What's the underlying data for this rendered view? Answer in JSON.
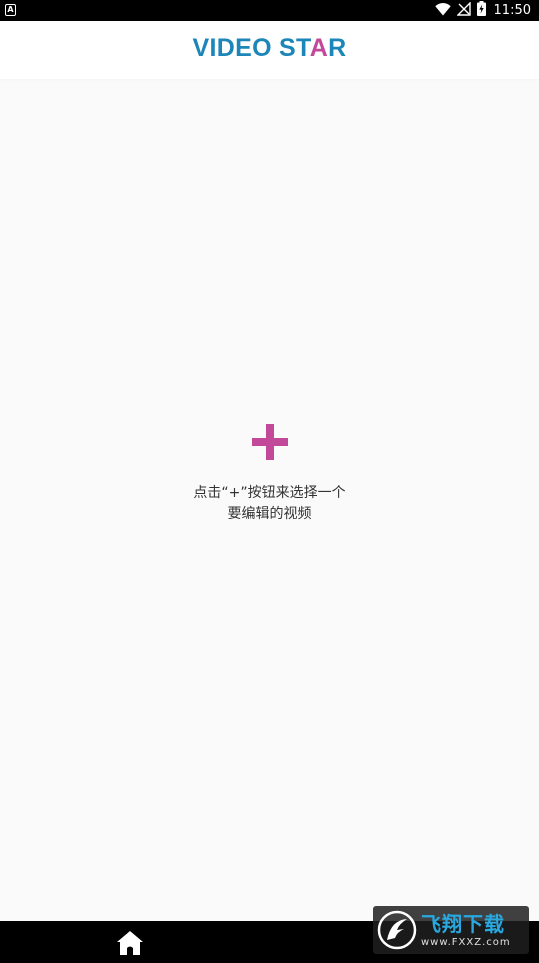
{
  "status_bar": {
    "app_indicator": "A",
    "time": "11:50",
    "icons": [
      "wifi-icon",
      "signal-off-icon",
      "battery-charging-icon"
    ]
  },
  "app_bar": {
    "title_part1": "VIDEO ST",
    "title_accent": "A",
    "title_part2": "R",
    "title_color": "#1d86b8",
    "accent_color": "#c2489a"
  },
  "empty_state": {
    "add_icon": "plus-icon",
    "hint_line1": "点击“+”按钮来选择一个",
    "hint_line2": "要编辑的视频"
  },
  "nav_bar": {
    "home_icon": "home-icon"
  },
  "watermark": {
    "name": "飞翔下载",
    "url": "www.FXXZ.com"
  }
}
